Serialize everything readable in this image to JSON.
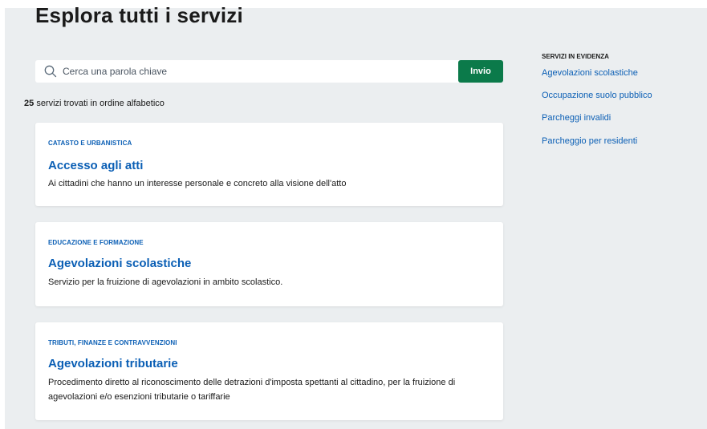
{
  "page": {
    "title": "Esplora tutti i servizi"
  },
  "search": {
    "placeholder": "Cerca una parola chiave",
    "value": "",
    "button_label": "Invio"
  },
  "results": {
    "count": "25",
    "summary": "servizi trovati in ordine alfabetico"
  },
  "services": [
    {
      "category": "CATASTO E URBANISTICA",
      "title": "Accesso agli atti",
      "description": "Ai cittadini che hanno un interesse personale e concreto alla visione dell'atto"
    },
    {
      "category": "EDUCAZIONE E FORMAZIONE",
      "title": "Agevolazioni scolastiche",
      "description": "Servizio per la fruizione di agevolazioni in ambito scolastico."
    },
    {
      "category": "TRIBUTI, FINANZE E CONTRAVVENZIONI",
      "title": "Agevolazioni tributarie",
      "description": "Procedimento diretto al riconoscimento delle detrazioni d'imposta spettanti al cittadino, per la fruizione di agevolazioni e/o esenzioni tributarie o tariffarie"
    }
  ],
  "featured": {
    "title": "SERVIZI IN EVIDENZA",
    "links": [
      "Agevolazioni scolastiche",
      "Occupazione suolo pubblico",
      "Parcheggi invalidi",
      "Parcheggio per residenti"
    ]
  },
  "colors": {
    "background": "#ebeef0",
    "accent": "#0b5fb5",
    "button": "#0b7a4a"
  }
}
